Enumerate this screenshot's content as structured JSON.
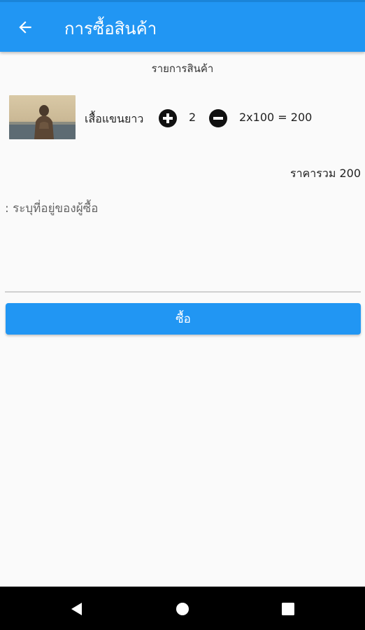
{
  "appbar": {
    "title": "การซื้อสินค้า",
    "back_icon": "arrow-back-icon",
    "background_color": "#2196f3"
  },
  "cart": {
    "section_label": "รายการสินค้า",
    "items": [
      {
        "name": "เสื้อแขนยาว",
        "quantity": "2",
        "line_total": "2x100 = 200",
        "thumbnail_icon": "product-photo-person-by-sea"
      }
    ],
    "total_label": "ราคารวม 200"
  },
  "address": {
    "placeholder": ": ระบุที่อยู่ของผู้ซื้อ",
    "value": ""
  },
  "buy_button": {
    "label": "ซื้อ",
    "color": "#2196f3"
  },
  "system_nav": {
    "back_icon": "nav-back-triangle-icon",
    "home_icon": "nav-home-circle-icon",
    "recents_icon": "nav-recents-square-icon"
  }
}
